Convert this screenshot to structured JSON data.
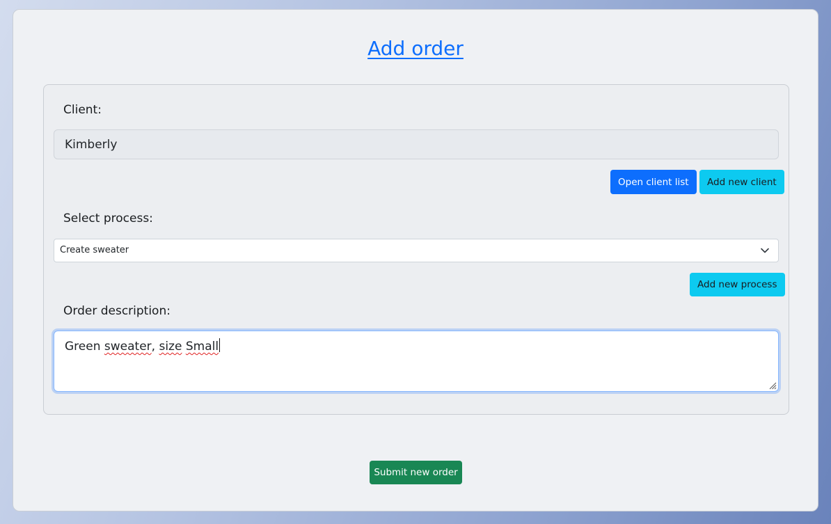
{
  "page": {
    "title": "Add order"
  },
  "client": {
    "label": "Client:",
    "value": "Kimberly",
    "open_list_label": "Open client list",
    "add_new_label": "Add new client"
  },
  "process": {
    "label": "Select process:",
    "selected": "Create sweater",
    "add_new_label": "Add new process"
  },
  "description": {
    "label": "Order description:",
    "parts": [
      "Green ",
      "sweater",
      ", ",
      "size",
      " ",
      "Small"
    ]
  },
  "submit": {
    "label": "Submit new order"
  },
  "colors": {
    "primary": "#0d6efd",
    "info": "#0dcaf0",
    "success": "#198754"
  },
  "icons": {
    "select_arrow": "chevron-down-icon",
    "textarea_resize": "resize-handle-icon"
  }
}
